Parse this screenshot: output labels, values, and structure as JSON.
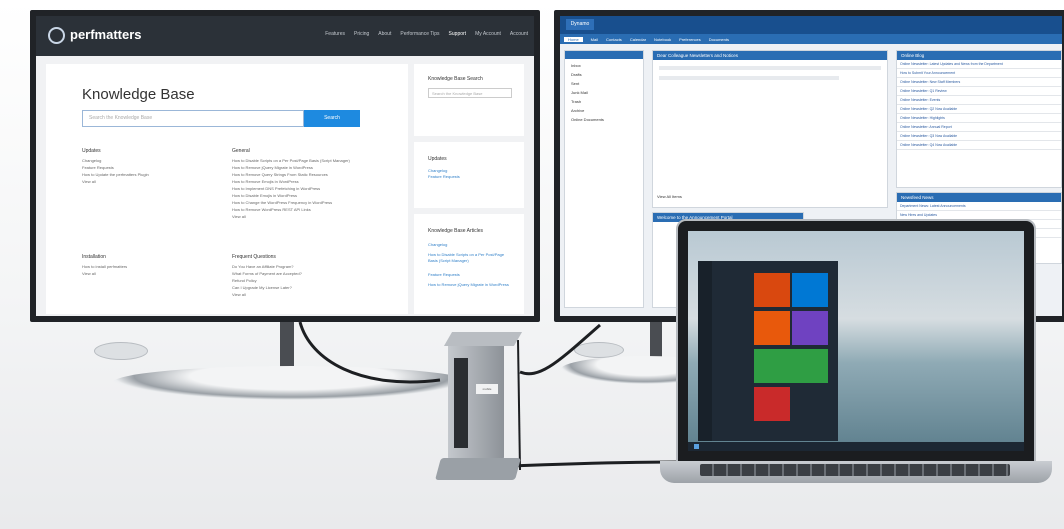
{
  "left_monitor": {
    "brand": "perfmatters",
    "nav": [
      "Features",
      "Pricing",
      "About",
      "Performance Tips",
      "Support",
      "My Account",
      "Account"
    ],
    "kb_title": "Knowledge Base",
    "search_placeholder": "Search the Knowledge Base",
    "search_button": "Search",
    "sections": [
      {
        "title": "Updates",
        "items": [
          "Changelog",
          "Feature Requests",
          "How to Update the perfmatters Plugin",
          "View all"
        ]
      },
      {
        "title": "General",
        "items": [
          "How to Disable Scripts on a Per Post/Page Basis (Script Manager)",
          "How to Remove jQuery Migrate in WordPress",
          "How to Remove Query Strings From Static Resources",
          "How to Remove Emojis in WordPress",
          "How to Implement DNS Prefetching in WordPress",
          "How to Disable Emojis in WordPress",
          "How to Change the WordPress Frequency in WordPress",
          "How to Remove WordPress REST API Links",
          "View all"
        ]
      },
      {
        "title": "Installation",
        "items": [
          "How to install perfmatters",
          "View all"
        ]
      },
      {
        "title": "Frequent Questions",
        "items": [
          "Do You Have an Affiliate Program?",
          "What Forms of Payment are Accepted?",
          "Refund Policy",
          "Can I Upgrade My License Later?",
          "View all"
        ]
      }
    ],
    "sidebar": {
      "search_title": "Knowledge Base Search",
      "search_placeholder": "Search the Knowledge Base",
      "updates_title": "Updates",
      "updates_links": [
        "Changelog",
        "Feature Requests"
      ],
      "articles_title": "Knowledge Base Articles",
      "articles_links": [
        "Changelog",
        "How to Disable Scripts on a Per Post/Page Basis (Script Manager)",
        "Feature Requests",
        "How to Remove jQuery Migrate in WordPress"
      ]
    }
  },
  "right_monitor": {
    "logo": "Dynamo",
    "tabs": [
      "Home",
      "Mail",
      "Contacts",
      "Calendar",
      "Notebook",
      "Preferences",
      "Documents"
    ],
    "left_items": [
      "Inbox",
      "Drafts",
      "Sent",
      "Junk Mail",
      "Trash",
      "Archive",
      "Online Documents"
    ],
    "panel1_title": "Dear Colleague Newsletters and Notices",
    "panel1_footer": "View All Items",
    "panel2_title": "Welcome to the Announcement Portal",
    "blog_title": "Online Blog",
    "blog_items": [
      "Online Newsletter: Latest Updates and News from the Department",
      "How to Submit Your Announcement",
      "Online Newsletter: New Staff Members",
      "Online Newsletter: Q1 Review",
      "Online Newsletter: Events",
      "Online Newsletter: Q2 Now Available",
      "Online Newsletter: Highlights",
      "Online Newsletter: Annual Report",
      "Online Newsletter: Q3 Now Available",
      "Online Newsletter: Q4 Now Available"
    ],
    "news_title": "Newsfeed News",
    "news_items": [
      "Department News: Latest Announcements",
      "New Hires and Updates",
      "Upcoming Events This Month",
      "Policy Changes and Reminders"
    ]
  },
  "laptop": {
    "tile_colors": [
      "#d9480f",
      "#0078d4",
      "#e8590c",
      "#6f42c1",
      "#2f9e44",
      "#c92a2a"
    ]
  },
  "dock": {
    "label": "mobile"
  }
}
